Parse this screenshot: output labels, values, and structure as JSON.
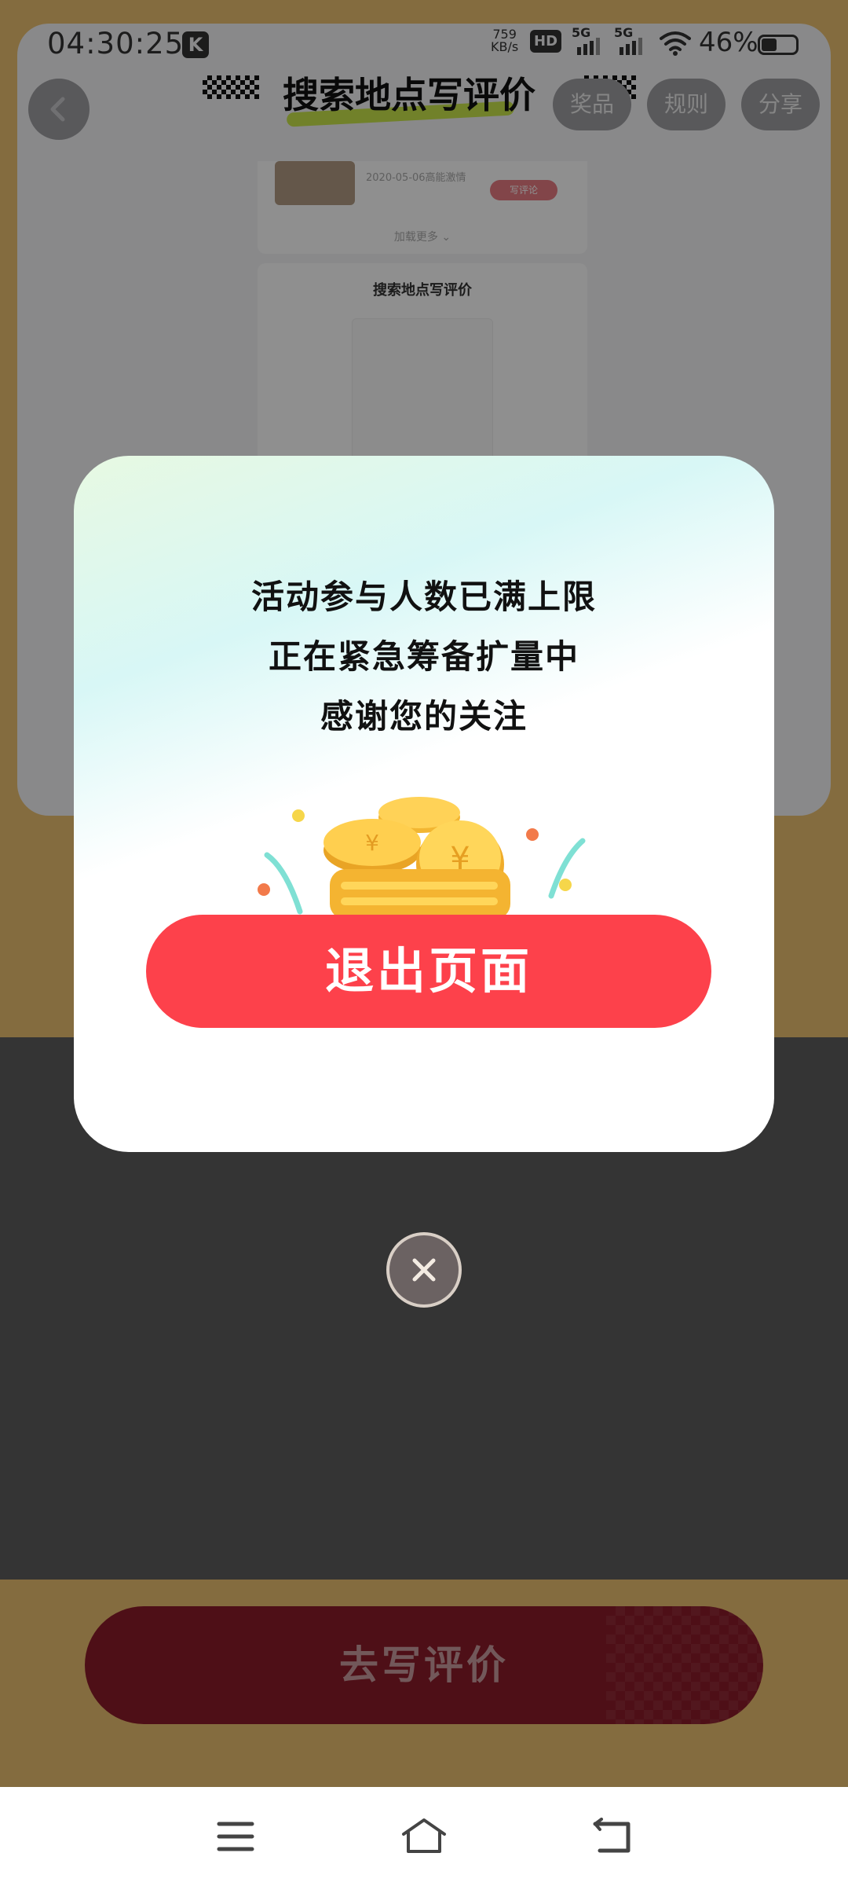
{
  "status_bar": {
    "time": "04:30:25",
    "k_badge": "K",
    "net_speed_value": "759",
    "net_speed_unit": "KB/s",
    "hd_label": "HD",
    "sim1_label": "5G",
    "sim2_label": "5G",
    "battery_text": "46%",
    "battery_level": 0.46
  },
  "header": {
    "title": "搜索地点写评价",
    "prize_label": "奖品",
    "rules_label": "规则",
    "share_label": "分享"
  },
  "preview": {
    "date": "2020-05-06高能激情",
    "review_button": "写评论",
    "load_more": "加载更多 ⌄",
    "card_title": "搜索地点写评价"
  },
  "dialog": {
    "line1": "活动参与人数已满上限",
    "line2": "正在紧急筹备扩量中",
    "line3": "感谢您的关注",
    "exit_label": "退出页面"
  },
  "cta": {
    "label": "去写评价"
  },
  "colors": {
    "accent_red": "#fd414b",
    "page_yellow": "#ecc070"
  }
}
